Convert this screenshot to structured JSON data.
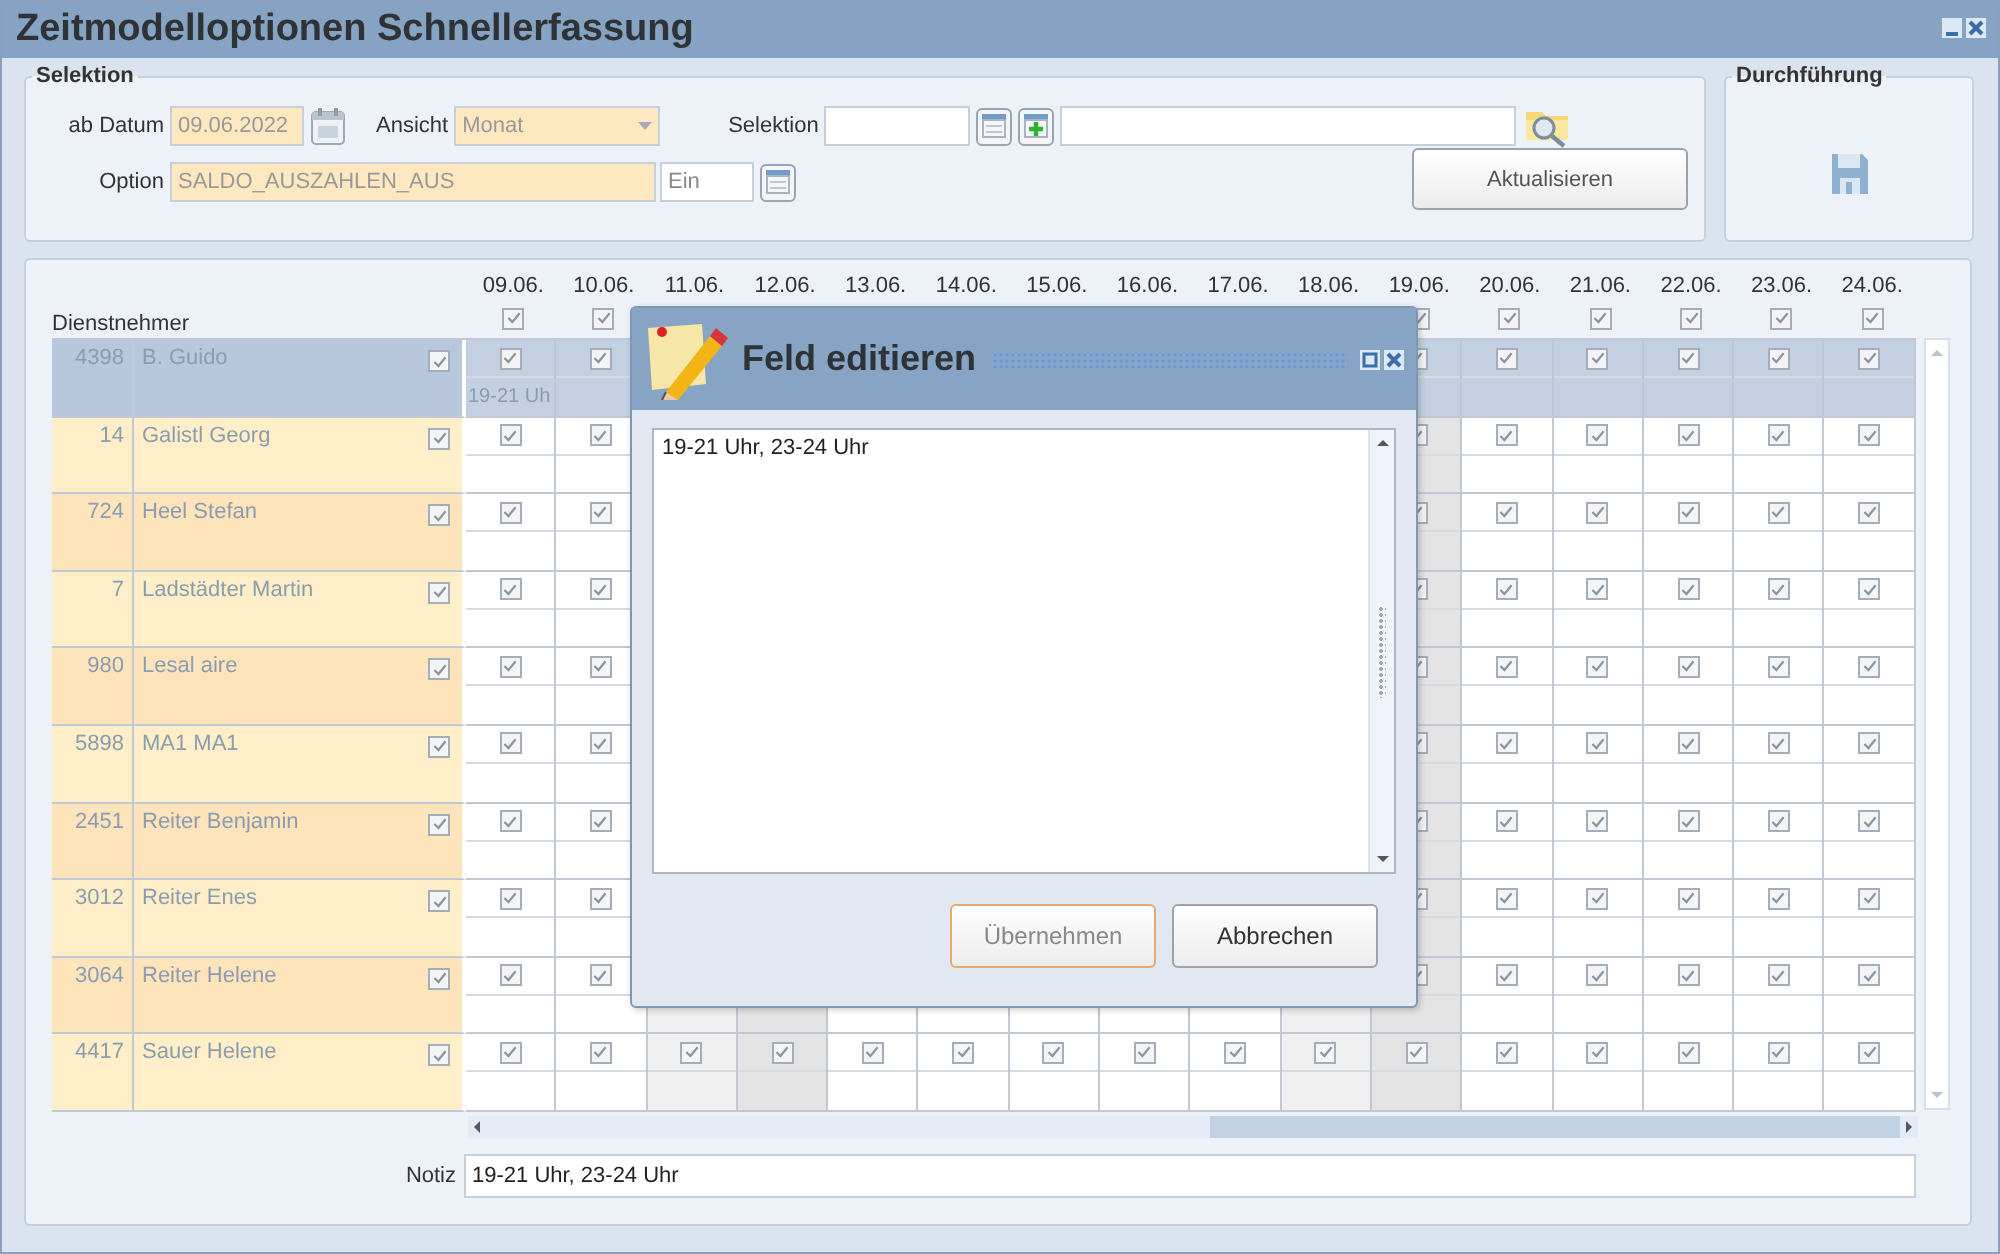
{
  "window": {
    "title": "Zeitmodelloptionen Schnellerfassung"
  },
  "selection": {
    "title": "Selektion",
    "date_label": "ab Datum",
    "date": "09.06.2022",
    "view_label": "Ansicht",
    "view": "Monat",
    "selection_label": "Selektion",
    "option_label": "Option",
    "option": "SALDO_AUSZAHLEN_AUS",
    "option_value": "Ein",
    "refresh_button": "Aktualisieren"
  },
  "execution": {
    "title": "Durchführung"
  },
  "grid": {
    "employee_header": "Dienstnehmer",
    "columns": [
      {
        "date": "09.06.",
        "kind": "weekday",
        "checked": true
      },
      {
        "date": "10.06.",
        "kind": "weekday",
        "checked": true
      },
      {
        "date": "11.06.",
        "kind": "saturday"
      },
      {
        "date": "12.06.",
        "kind": "sunday"
      },
      {
        "date": "13.06.",
        "kind": "weekday"
      },
      {
        "date": "14.06.",
        "kind": "weekday"
      },
      {
        "date": "15.06.",
        "kind": "weekday"
      },
      {
        "date": "16.06.",
        "kind": "weekday"
      },
      {
        "date": "17.06.",
        "kind": "weekday"
      },
      {
        "date": "18.06.",
        "kind": "saturday"
      },
      {
        "date": "19.06.",
        "kind": "sunday",
        "checked": true
      },
      {
        "date": "20.06.",
        "kind": "weekday",
        "checked": true
      },
      {
        "date": "21.06.",
        "kind": "weekday",
        "checked": true
      },
      {
        "date": "22.06.",
        "kind": "weekday",
        "checked": true
      },
      {
        "date": "23.06.",
        "kind": "weekday",
        "checked": true
      },
      {
        "date": "24.06.",
        "kind": "weekday",
        "checked": true
      }
    ],
    "rows": [
      {
        "id": "4398",
        "name": "B. Guido",
        "checked": true,
        "selected": true,
        "cells": [
          {
            "checked": true,
            "note": "19-21 Uh"
          },
          {
            "checked": true
          },
          {},
          {},
          {},
          {},
          {},
          {},
          {},
          {},
          {
            "checked": true
          },
          {
            "checked": true
          },
          {
            "checked": true
          },
          {
            "checked": true
          },
          {
            "checked": true
          },
          {
            "checked": true
          }
        ]
      },
      {
        "id": "14",
        "name": "Galistl Georg",
        "checked": true,
        "selected": false,
        "cells": [
          {
            "checked": true
          },
          {
            "checked": true
          },
          {},
          {},
          {},
          {},
          {},
          {},
          {},
          {},
          {
            "checked": true
          },
          {
            "checked": true
          },
          {
            "checked": true
          },
          {
            "checked": true
          },
          {
            "checked": true
          },
          {
            "checked": true
          }
        ]
      },
      {
        "id": "724",
        "name": "Heel Stefan",
        "checked": true,
        "selected": false,
        "cells": [
          {
            "checked": true
          },
          {
            "checked": true
          },
          {},
          {},
          {},
          {},
          {},
          {},
          {},
          {},
          {
            "checked": true
          },
          {
            "checked": true
          },
          {
            "checked": true
          },
          {
            "checked": true
          },
          {
            "checked": true
          },
          {
            "checked": true
          }
        ]
      },
      {
        "id": "7",
        "name": "Ladstädter Martin",
        "checked": true,
        "selected": false,
        "cells": [
          {
            "checked": true
          },
          {
            "checked": true
          },
          {},
          {},
          {},
          {},
          {},
          {},
          {},
          {},
          {
            "checked": true
          },
          {
            "checked": true
          },
          {
            "checked": true
          },
          {
            "checked": true
          },
          {
            "checked": true
          },
          {
            "checked": true
          }
        ]
      },
      {
        "id": "980",
        "name": "Lesal aire",
        "checked": true,
        "selected": false,
        "cells": [
          {
            "checked": true
          },
          {
            "checked": true
          },
          {},
          {},
          {},
          {},
          {},
          {},
          {},
          {},
          {
            "checked": true
          },
          {
            "checked": true
          },
          {
            "checked": true
          },
          {
            "checked": true
          },
          {
            "checked": true
          },
          {
            "checked": true
          }
        ]
      },
      {
        "id": "5898",
        "name": "MA1 MA1",
        "checked": true,
        "selected": false,
        "cells": [
          {
            "checked": true
          },
          {
            "checked": true
          },
          {},
          {},
          {},
          {},
          {},
          {},
          {},
          {},
          {
            "checked": true
          },
          {
            "checked": true
          },
          {
            "checked": true
          },
          {
            "checked": true
          },
          {
            "checked": true
          },
          {
            "checked": true
          }
        ]
      },
      {
        "id": "2451",
        "name": "Reiter Benjamin",
        "checked": true,
        "selected": false,
        "cells": [
          {
            "checked": true
          },
          {
            "checked": true
          },
          {},
          {},
          {},
          {},
          {},
          {},
          {},
          {},
          {
            "checked": true
          },
          {
            "checked": true
          },
          {
            "checked": true
          },
          {
            "checked": true
          },
          {
            "checked": true
          },
          {
            "checked": true
          }
        ]
      },
      {
        "id": "3012",
        "name": "Reiter Enes",
        "checked": true,
        "selected": false,
        "cells": [
          {
            "checked": true
          },
          {
            "checked": true
          },
          {},
          {},
          {},
          {},
          {},
          {},
          {},
          {},
          {
            "checked": true
          },
          {
            "checked": true
          },
          {
            "checked": true
          },
          {
            "checked": true
          },
          {
            "checked": true
          },
          {
            "checked": true
          }
        ]
      },
      {
        "id": "3064",
        "name": "Reiter Helene",
        "checked": true,
        "selected": false,
        "cells": [
          {
            "checked": true
          },
          {
            "checked": true
          },
          {},
          {},
          {},
          {},
          {},
          {},
          {},
          {},
          {
            "checked": true
          },
          {
            "checked": true
          },
          {
            "checked": true
          },
          {
            "checked": true
          },
          {
            "checked": true
          },
          {
            "checked": true
          }
        ]
      },
      {
        "id": "4417",
        "name": "Sauer Helene",
        "checked": true,
        "selected": false,
        "cells": [
          {
            "checked": true
          },
          {
            "checked": true
          },
          {
            "checked": true
          },
          {
            "checked": true
          },
          {
            "checked": true
          },
          {
            "checked": true
          },
          {
            "checked": true
          },
          {
            "checked": true
          },
          {
            "checked": true
          },
          {
            "checked": true
          },
          {
            "checked": true
          },
          {
            "checked": true
          },
          {
            "checked": true
          },
          {
            "checked": true
          },
          {
            "checked": true
          },
          {
            "checked": true
          }
        ]
      }
    ]
  },
  "note": {
    "label": "Notiz",
    "value": "19-21 Uhr, 23-24 Uhr"
  },
  "dialog": {
    "title": "Feld editieren",
    "text": "19-21 Uhr, 23-24 Uhr",
    "buttons": [
      {
        "label": "Übernehmen",
        "focused": true
      },
      {
        "label": "Abbrechen",
        "focused": false
      }
    ]
  }
}
